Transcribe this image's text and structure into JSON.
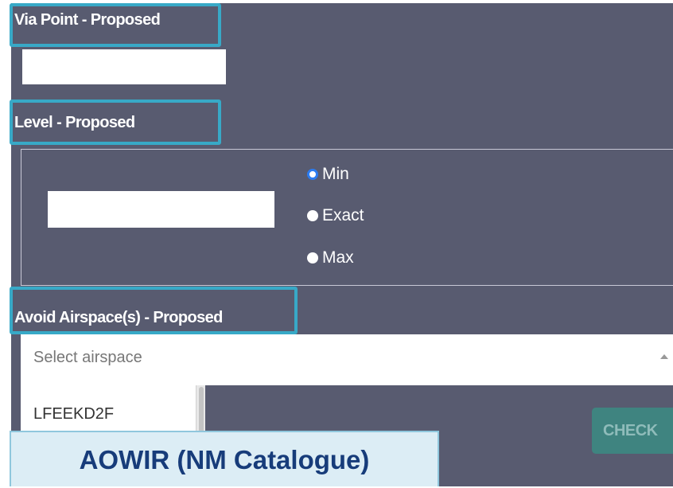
{
  "form": {
    "via_point_label": "Via Point - Proposed",
    "via_point_value": "",
    "level_label": "Level - Proposed",
    "level_value": "",
    "level_options": [
      "Min",
      "Exact",
      "Max"
    ],
    "level_selected": "Min",
    "avoid_label": "Avoid Airspace(s) - Proposed",
    "avoid_placeholder": "Select airspace",
    "avoid_dropdown_items": [
      "LFEEKD2F"
    ],
    "check_button_label": "CHECK"
  },
  "banner": {
    "text": "AOWIR (NM Catalogue)"
  },
  "colors": {
    "panel_background": "#585b70",
    "highlight_border": "#38a9c7",
    "radio_selected": "#2b7bf0",
    "check_button": "#3f8480",
    "banner_text": "#173c7a",
    "banner_background": "#dcedf5"
  }
}
